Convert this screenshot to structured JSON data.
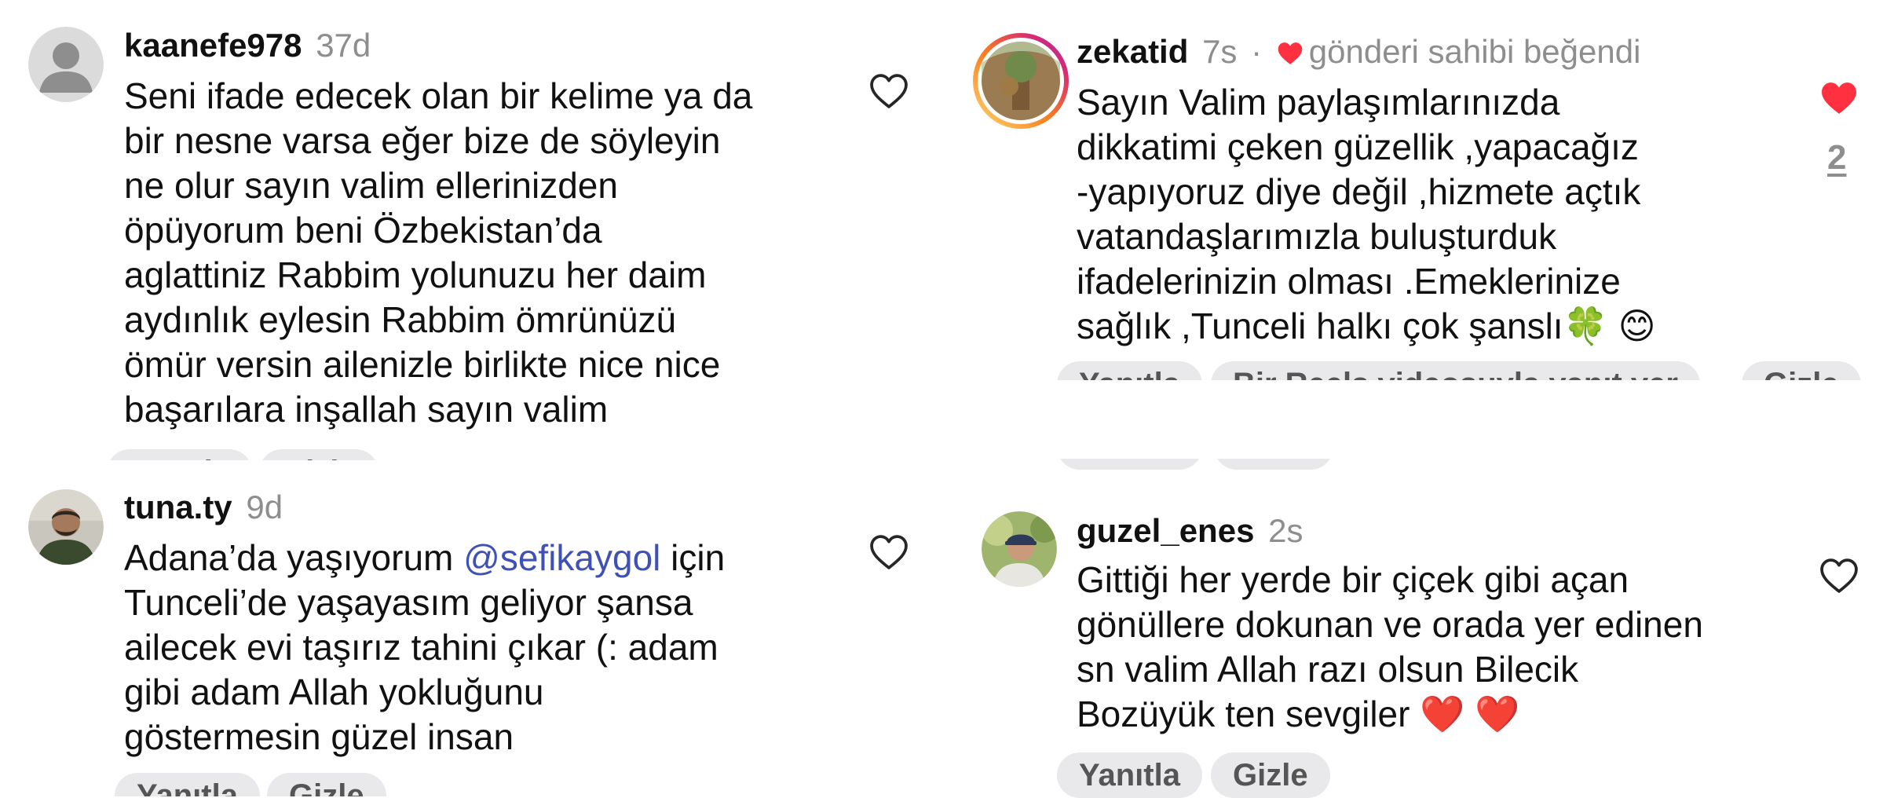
{
  "comments": [
    {
      "username": "kaanefe978",
      "time": "37d",
      "lines": [
        "Seni ifade edecek olan bir kelime ya da",
        "bir nesne varsa eğer bize de söyleyin",
        "ne olur sayın valim ellerinizden",
        "öpüyorum beni Özbekistan’da",
        "aglattiniz Rabbim yolunuzu her daim",
        "aydınlık eylesin Rabbim ömrünüzü",
        "ömür versin ailenizle birlikte nice nice",
        "başarılara inşallah sayın valim"
      ],
      "actions": [
        "Yanıtla",
        "Gizle"
      ]
    },
    {
      "username": "zekatid",
      "time": "7s",
      "liked_by_author": "gönderi sahibi beğendi",
      "lines": [
        "Sayın Valim paylaşımlarınızda",
        "dikkatimi çeken güzellik ,yapacağız",
        "-yapıyoruz diye değil ,hizmete açtık",
        "vatandaşlarımızla buluşturduk",
        "ifadelerinizin olması .Emeklerinize",
        "sağlık ,Tunceli halkı çok şanslı"
      ],
      "emoji": [
        "🍀",
        "😊"
      ],
      "like_count": "2",
      "actions": [
        "Yanıtla",
        "Bir Reels videosuyla yanıt ver",
        "Gizle"
      ],
      "hidden_actions": [
        "Yanıtla",
        "Gizle"
      ]
    },
    {
      "username": "tuna.ty",
      "time": "9d",
      "line1_before": "Adana’da yaşıyorum ",
      "mention": "@sefikaygol",
      "line1_after": " için",
      "lines": [
        "Tunceli’de yaşayasım geliyor şansa",
        "ailecek evi taşırız tahini çıkar (: adam",
        "gibi adam Allah yokluğunu",
        "göstermesin güzel insan"
      ],
      "actions": [
        "Yanıtla",
        "Gizle"
      ]
    },
    {
      "username": "guzel_enes",
      "time": "2s",
      "lines": [
        "Gittiği her yerde bir çiçek gibi açan",
        "gönüllere dokunan ve orada yer edinen",
        "sn valim Allah razı olsun Bilecik",
        "Bozüyük ten sevgiler"
      ],
      "emoji": [
        "❤️",
        "❤️"
      ],
      "actions": [
        "Yanıtla",
        "Gizle"
      ]
    }
  ],
  "colors": {
    "heart_liked": "#ff3040",
    "muted_text": "#8e8e8e",
    "mention": "#3f51b5",
    "pill_bg": "#e9e9ec",
    "story_ring_start": "#feda75",
    "story_ring_end": "#d62976"
  },
  "icons": {
    "like_outline": "heart-outline-icon",
    "like_filled": "heart-filled-icon",
    "default_avatar": "default-avatar-icon"
  }
}
